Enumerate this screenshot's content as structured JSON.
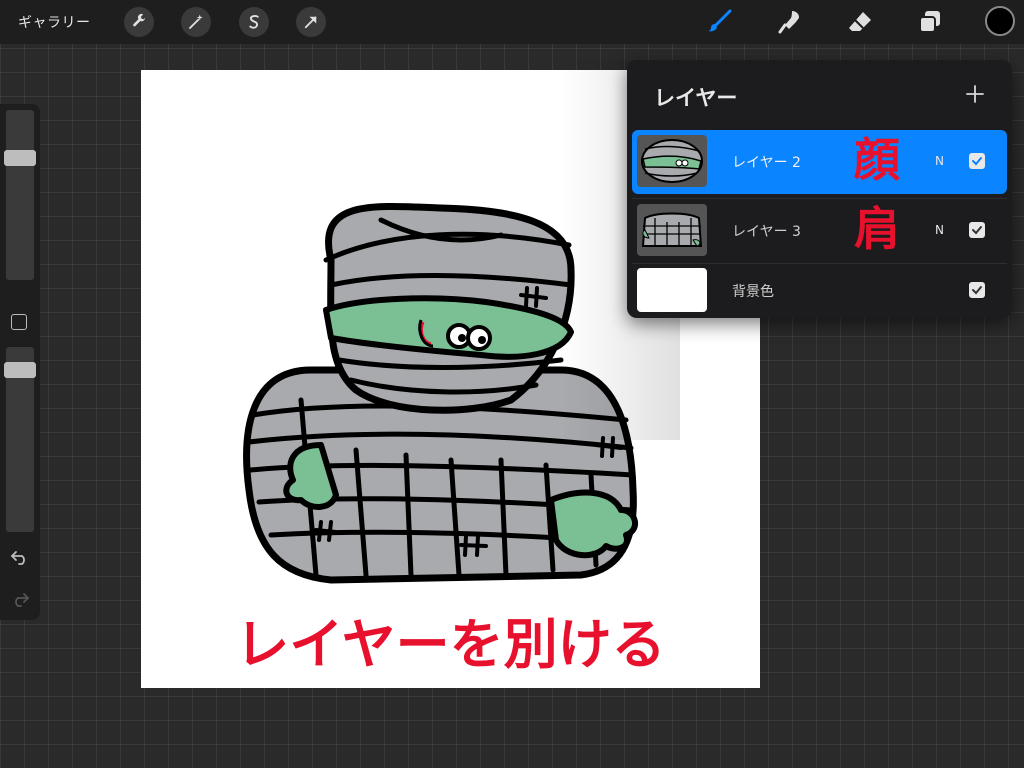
{
  "toolbar": {
    "gallery_label": "ギャラリー",
    "left_tools": [
      "wrench-icon",
      "magic-wand-icon",
      "selection-s-icon",
      "transform-arrow-icon"
    ],
    "right_tools": [
      "brush-icon",
      "smudge-icon",
      "eraser-icon",
      "layers-icon"
    ],
    "active_tool": "brush",
    "accent_color": "#0a84ff",
    "current_color": "#000000"
  },
  "sidebar": {
    "brush_size_level": 0.74,
    "opacity_level": 0.91
  },
  "canvas": {
    "caption": "レイヤーを別ける",
    "caption_color": "#e8112d"
  },
  "layers_panel": {
    "title": "レイヤー",
    "layers": [
      {
        "name": "レイヤー 2",
        "blend": "N",
        "visible": true,
        "active": true,
        "annotation": "顔"
      },
      {
        "name": "レイヤー 3",
        "blend": "N",
        "visible": true,
        "active": false,
        "annotation": "肩"
      },
      {
        "name": "背景色",
        "visible": true,
        "active": false
      }
    ]
  }
}
